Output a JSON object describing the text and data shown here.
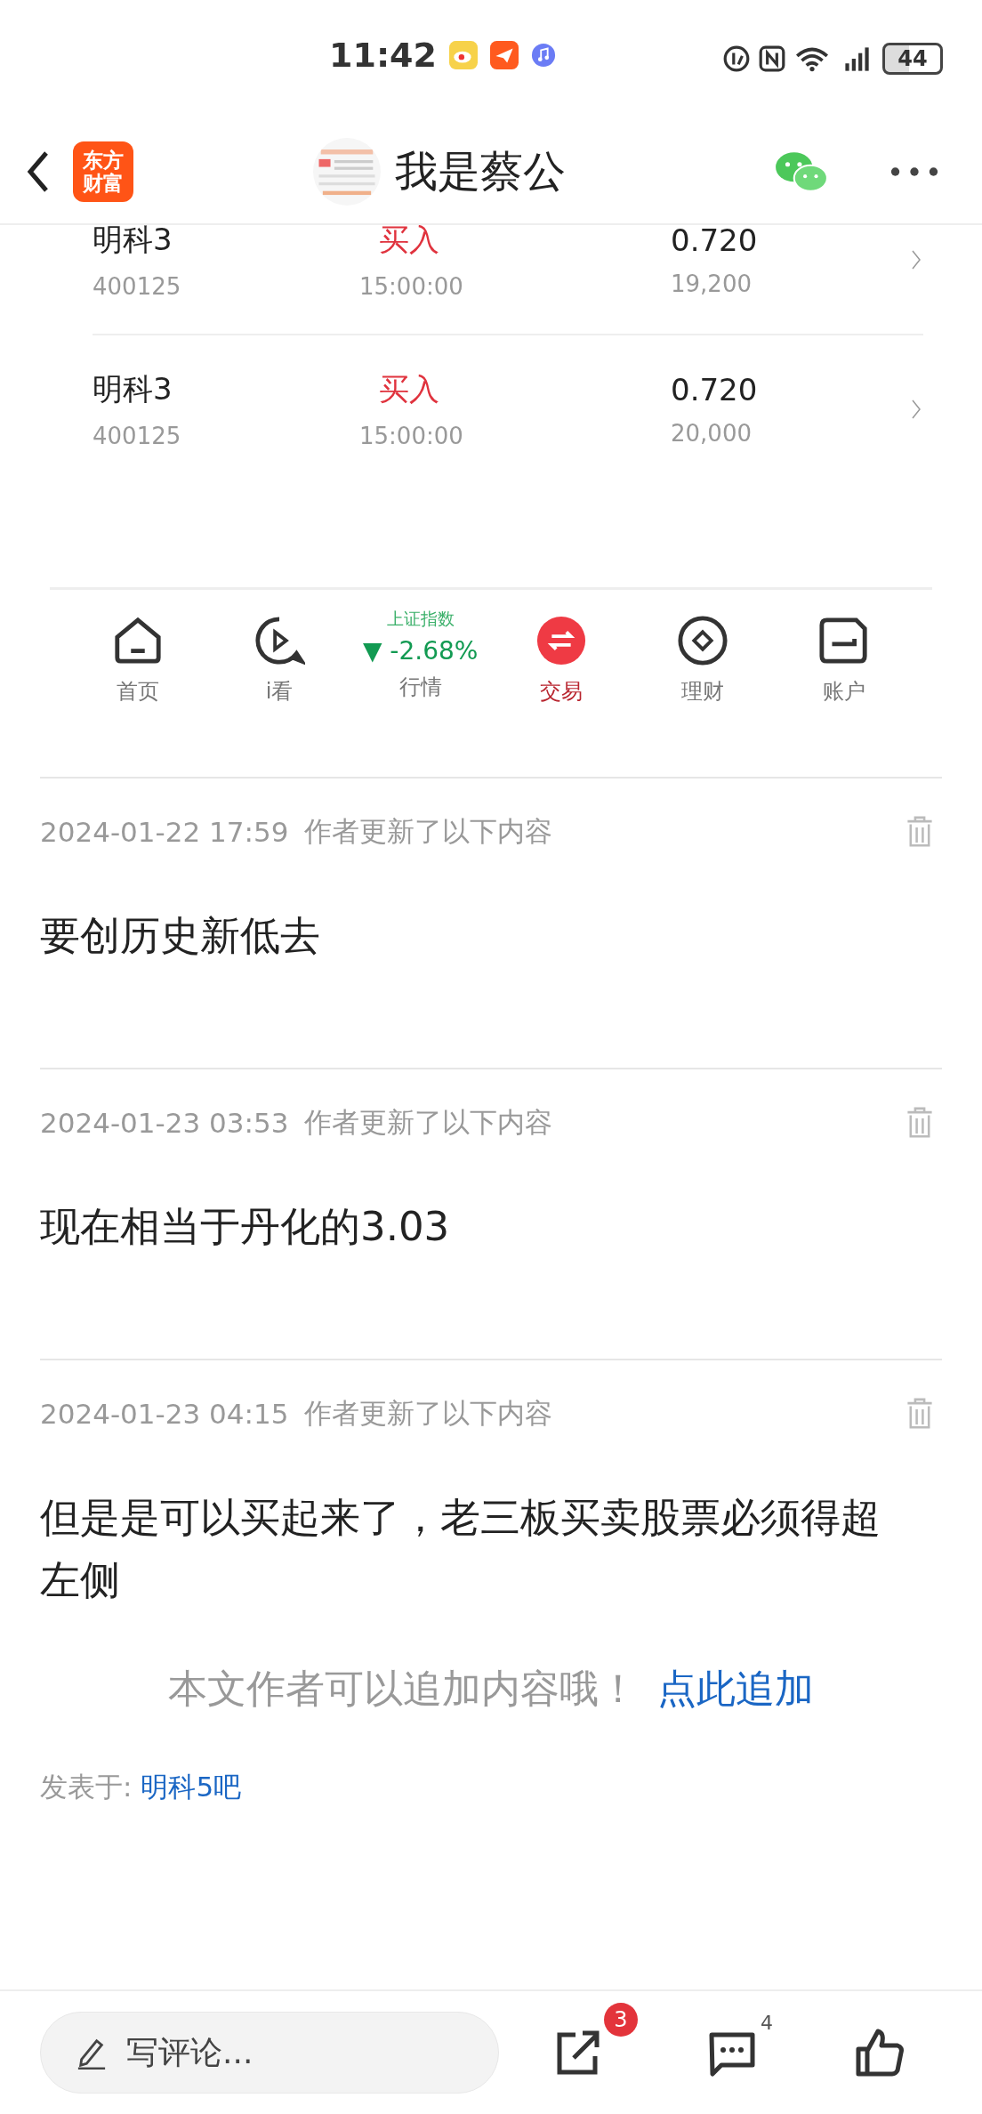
{
  "status_bar": {
    "time": "11:42",
    "battery": "44"
  },
  "header": {
    "logo_lines": [
      "东方",
      "财富"
    ],
    "title": "我是蔡公"
  },
  "trades": [
    {
      "name": "明科3",
      "code": "400125",
      "action": "买入",
      "time": "15:00:00",
      "price": "0.720",
      "quantity": "19,200"
    },
    {
      "name": "明科3",
      "code": "400125",
      "action": "买入",
      "time": "15:00:00",
      "price": "0.720",
      "quantity": "20,000"
    }
  ],
  "nav": [
    {
      "kind": "home",
      "label": "首页",
      "selected": false
    },
    {
      "kind": "watch",
      "label": "i看",
      "selected": false
    },
    {
      "kind": "market",
      "label": "行情",
      "selected": false,
      "index_name": "上证指数",
      "arrow": "▼",
      "change": "-2.68%"
    },
    {
      "kind": "trade",
      "label": "交易",
      "selected": true
    },
    {
      "kind": "finance",
      "label": "理财",
      "selected": false
    },
    {
      "kind": "account",
      "label": "账户",
      "selected": false
    }
  ],
  "updates": [
    {
      "timestamp": "2024-01-22 17:59",
      "note": "作者更新了以下内容",
      "text": "要创历史新低去"
    },
    {
      "timestamp": "2024-01-23 03:53",
      "note": "作者更新了以下内容",
      "text": "现在相当于丹化的3.03"
    },
    {
      "timestamp": "2024-01-23 04:15",
      "note": "作者更新了以下内容",
      "text": "但是是可以买起来了，老三板买卖股票必须得超左侧"
    }
  ],
  "append": {
    "prompt": "本文作者可以追加内容哦！",
    "link": "点此追加"
  },
  "posted_in": {
    "label": "发表于:",
    "forum": "明科5吧"
  },
  "bottom_bar": {
    "comment_placeholder": "写评论...",
    "share_badge": "3",
    "comment_count": "4"
  }
}
